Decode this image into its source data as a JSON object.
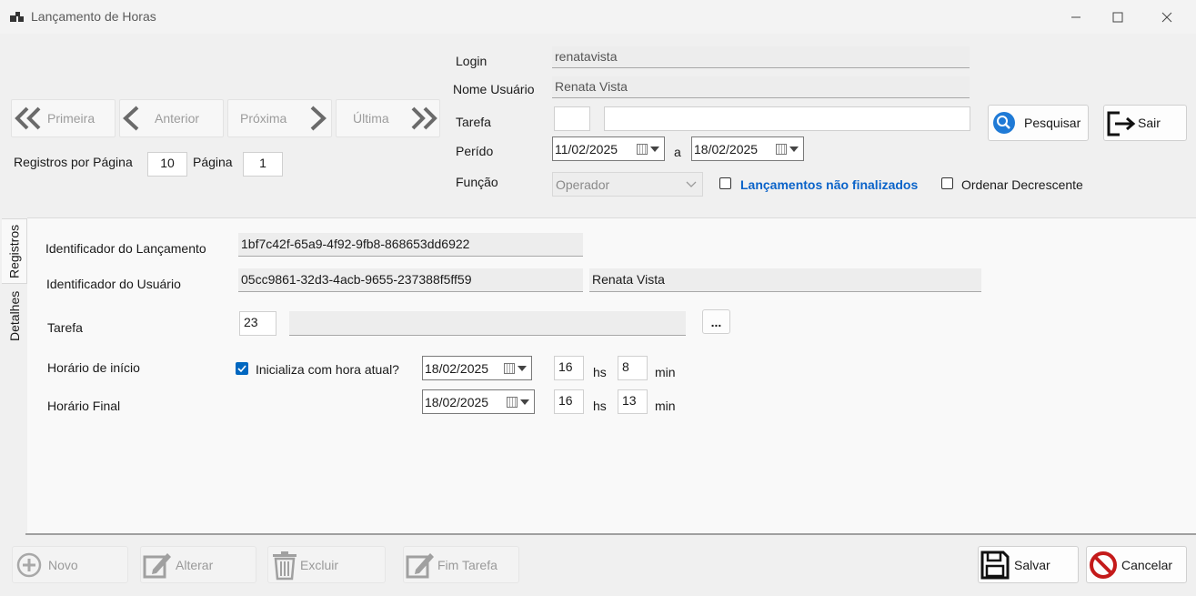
{
  "window": {
    "title": "Lançamento de Horas"
  },
  "nav": {
    "first": "Primeira",
    "prev": "Anterior",
    "next": "Próxima",
    "last": "Última",
    "records_per_page_label": "Registros por Página",
    "records_per_page": "10",
    "page_label": "Página",
    "page": "1"
  },
  "filters": {
    "login_label": "Login",
    "login": "renatavista",
    "user_name_label": "Nome Usuário",
    "user_name": "Renata Vista",
    "task_label": "Tarefa",
    "task_code": "",
    "task_desc": "",
    "period_label": "Perído",
    "period_from": "11/02/2025",
    "period_sep": "a",
    "period_to": "18/02/2025",
    "role_label": "Função",
    "role": "Operador",
    "unfinished_label": "Lançamentos não finalizados",
    "order_desc_label": "Ordenar Decrescente",
    "search_button": "Pesquisar",
    "exit_button": "Sair"
  },
  "tabs": {
    "registros": "Registros",
    "detalhes": "Detalhes"
  },
  "details": {
    "entry_id_label": "Identificador do Lançamento",
    "entry_id": "1bf7c42f-65a9-4f92-9fb8-868653dd6922",
    "user_id_label": "Identificador do Usuário",
    "user_id": "05cc9861-32d3-4acb-9655-237388f5ff59",
    "user_name": "Renata Vista",
    "task_label": "Tarefa",
    "task_code": "23",
    "task_desc": "",
    "task_browse": "...",
    "start_label": "Horário de início",
    "start_now_label": "Inicializa com hora atual?",
    "start_date": "18/02/2025",
    "start_hour": "16",
    "start_min": "8",
    "end_label": "Horário Final",
    "end_date": "18/02/2025",
    "end_hour": "16",
    "end_min": "13",
    "hs": "hs",
    "min": "min"
  },
  "actions": {
    "new": "Novo",
    "edit": "Alterar",
    "delete": "Excluir",
    "finish_task": "Fim Tarefa",
    "save": "Salvar",
    "cancel": "Cancelar"
  },
  "colors": {
    "accent": "#0067c0",
    "link": "#0a63c9",
    "cancel_red": "#c41a1a"
  }
}
